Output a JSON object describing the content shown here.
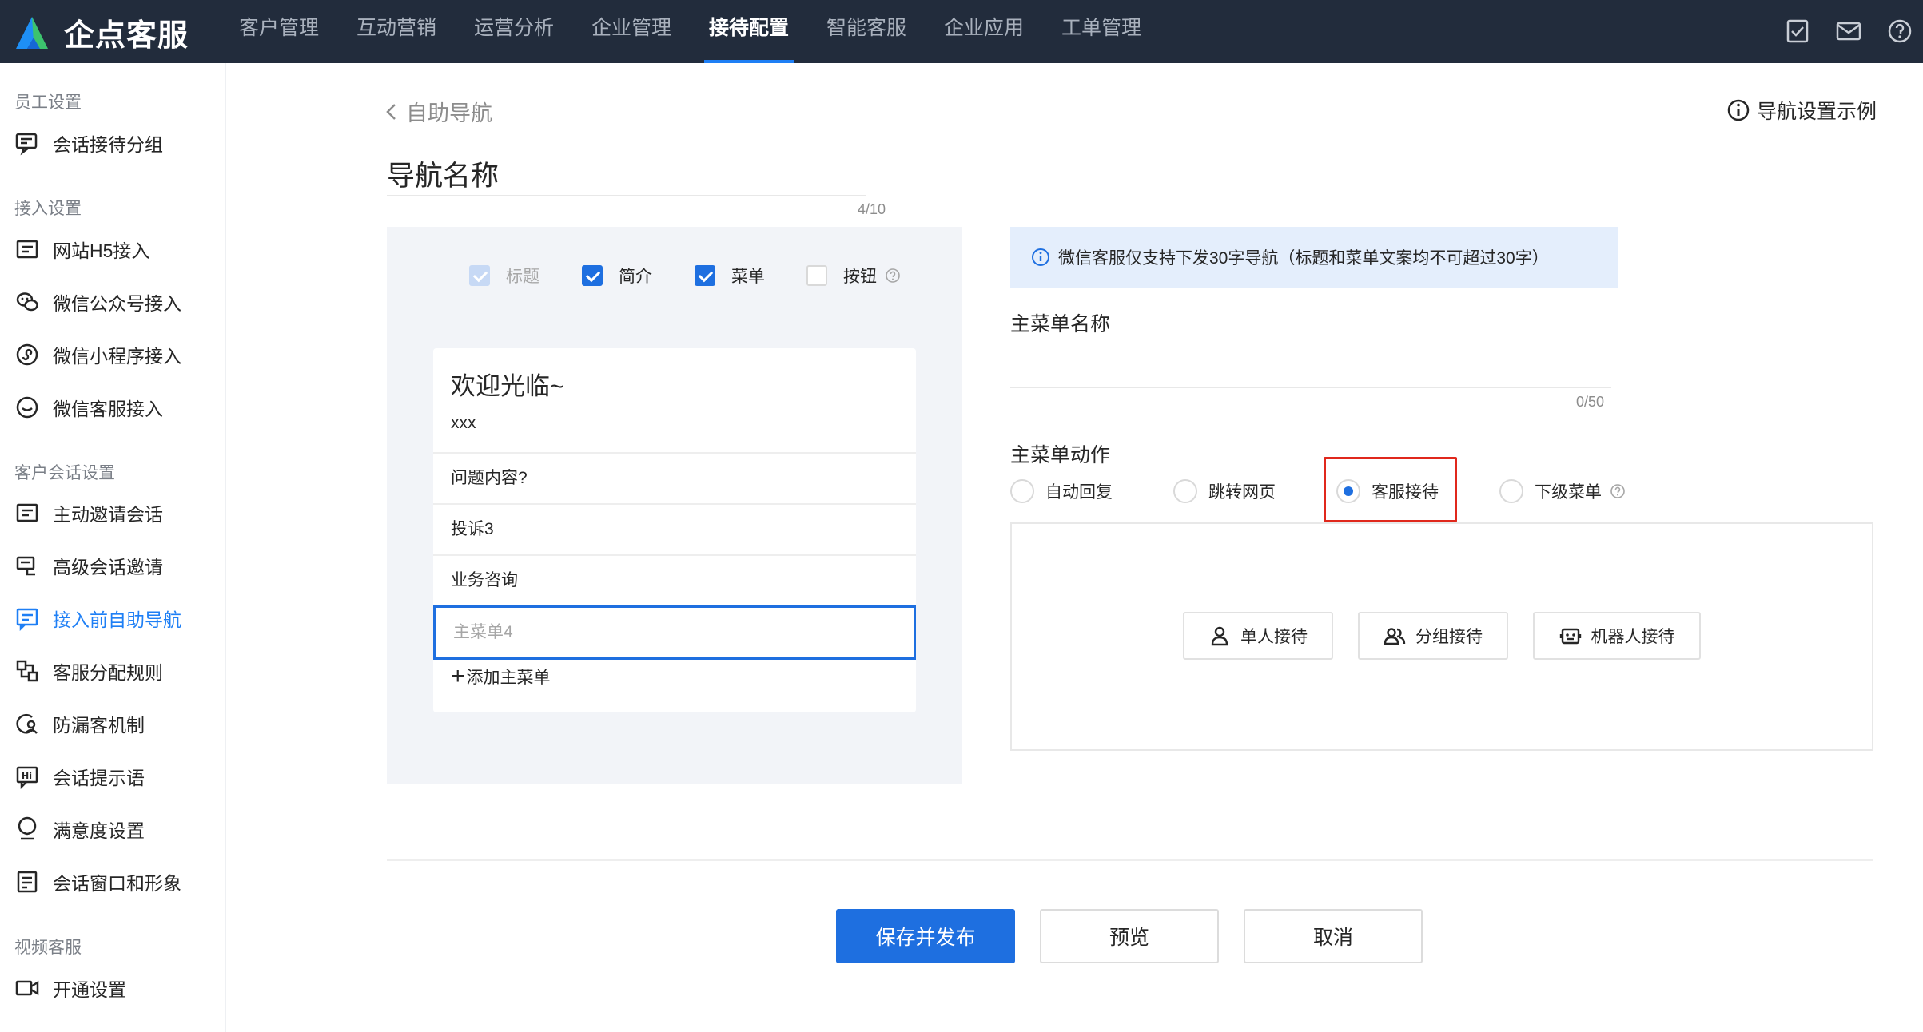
{
  "topbar": {
    "brand": "企点客服",
    "nav": [
      "客户管理",
      "互动营销",
      "运营分析",
      "企业管理",
      "接待配置",
      "智能客服",
      "企业应用",
      "工单管理"
    ],
    "active_nav": "接待配置",
    "icons": [
      "task-icon",
      "mail-icon",
      "help-icon"
    ]
  },
  "sidebar": {
    "groups": [
      {
        "title": "员工设置",
        "items": [
          {
            "label": "会话接待分组",
            "icon": "chat-group-icon"
          }
        ]
      },
      {
        "title": "接入设置",
        "items": [
          {
            "label": "网站H5接入",
            "icon": "web-icon"
          },
          {
            "label": "微信公众号接入",
            "icon": "wechat-icon"
          },
          {
            "label": "微信小程序接入",
            "icon": "miniprogram-icon"
          },
          {
            "label": "微信客服接入",
            "icon": "wechat-service-icon"
          }
        ]
      },
      {
        "title": "客户会话设置",
        "items": [
          {
            "label": "主动邀请会话",
            "icon": "invite-icon"
          },
          {
            "label": "高级会话邀请",
            "icon": "advanced-invite-icon"
          },
          {
            "label": "接入前自助导航",
            "icon": "navigation-icon"
          },
          {
            "label": "客服分配规则",
            "icon": "rules-icon"
          },
          {
            "label": "防漏客机制",
            "icon": "anti-miss-icon"
          },
          {
            "label": "会话提示语",
            "icon": "hint-icon"
          },
          {
            "label": "满意度设置",
            "icon": "satisfaction-icon"
          },
          {
            "label": "会话窗口和形象",
            "icon": "window-icon"
          }
        ]
      },
      {
        "title": "视频客服",
        "items": [
          {
            "label": "开通设置",
            "icon": "video-icon"
          }
        ]
      }
    ],
    "active_item": "接入前自助导航"
  },
  "page": {
    "back_label": "自助导航",
    "example_link": "导航设置示例",
    "nav_name_value": "导航名称",
    "nav_name_counter": "4/10"
  },
  "preview": {
    "checkboxes": [
      {
        "label": "标题",
        "state": "disabled-checked"
      },
      {
        "label": "简介",
        "state": "checked"
      },
      {
        "label": "菜单",
        "state": "checked"
      },
      {
        "label": "按钮",
        "state": "unchecked"
      }
    ],
    "card_title": "欢迎光临~",
    "card_subtitle": "xxx",
    "menu_items": [
      "问题内容?",
      "投诉3",
      "业务咨询"
    ],
    "editing_menu_placeholder": "主菜单4",
    "add_menu_label": "添加主菜单"
  },
  "settings": {
    "info_text": "微信客服仅支持下发30字导航（标题和菜单文案均不可超过30字）",
    "menu_name_label": "主菜单名称",
    "menu_name_value": "",
    "menu_name_counter": "0/50",
    "menu_action_label": "主菜单动作",
    "actions": [
      "自动回复",
      "跳转网页",
      "客服接待",
      "下级菜单"
    ],
    "selected_action": "客服接待",
    "reception_buttons": [
      "单人接待",
      "分组接待",
      "机器人接待"
    ]
  },
  "footer": {
    "save_label": "保存并发布",
    "preview_label": "预览",
    "cancel_label": "取消"
  },
  "colors": {
    "topbar": "#222c3c",
    "accent": "#1e6fe0",
    "highlight": "#e0281c"
  }
}
